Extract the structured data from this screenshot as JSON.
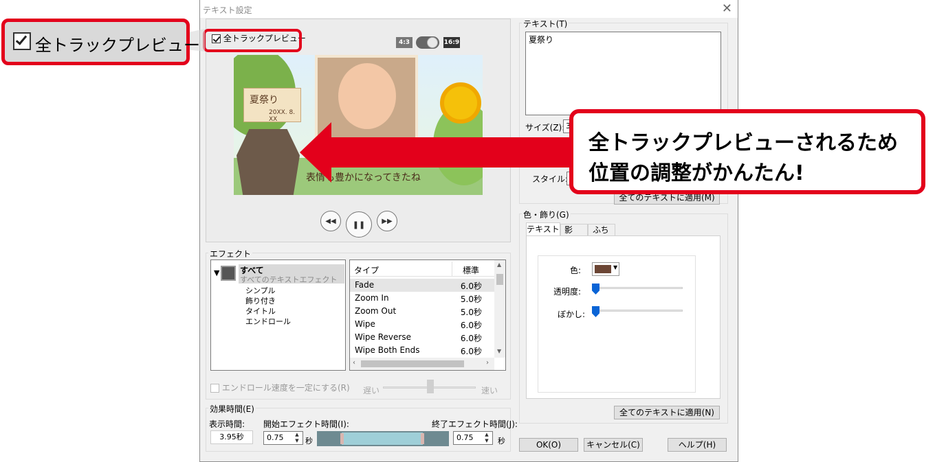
{
  "dialog": {
    "title": "テキスト設定",
    "all_track_preview_label": "全トラックプレビュー",
    "aspect_left": "4:3",
    "aspect_right": "16:9"
  },
  "callout": {
    "zoom_label": "全トラックプレビュー",
    "message_line1": "全トラックプレビューされるため",
    "message_line2": "位置の調整がかんたん!"
  },
  "preview": {
    "sign_title": "夏祭り",
    "sign_date": "20XX. 8. XX",
    "caption": "表情も豊かになってきたね"
  },
  "effects": {
    "legend": "エフェクト",
    "tree_root": "すべて",
    "tree_root_sub": "すべてのテキストエフェクト",
    "tree_items": [
      "シンプル",
      "飾り付き",
      "タイトル",
      "エンドロール"
    ],
    "col_type": "タイプ",
    "col_standard": "標準",
    "rows": [
      {
        "name": "Fade",
        "dur": "6.0秒"
      },
      {
        "name": "Zoom In",
        "dur": "5.0秒"
      },
      {
        "name": "Zoom Out",
        "dur": "5.0秒"
      },
      {
        "name": "Wipe",
        "dur": "6.0秒"
      },
      {
        "name": "Wipe Reverse",
        "dur": "6.0秒"
      },
      {
        "name": "Wipe Both Ends",
        "dur": "6.0秒"
      }
    ],
    "endroll_label": "エンドロール速度を一定にする(R)",
    "slow": "遅い",
    "fast": "速い"
  },
  "timing": {
    "legend": "効果時間(E)",
    "display_label": "表示時間:",
    "display_value": "3.95秒",
    "start_label": "開始エフェクト時間(I):",
    "start_value": "0.75",
    "end_label": "終了エフェクト時間(J):",
    "end_value": "0.75",
    "sec": "秒"
  },
  "text_panel": {
    "legend": "テキスト(T)",
    "text_value": "夏祭り",
    "size_label": "サイズ(Z):",
    "size_value": "3",
    "style_label": "スタイル:",
    "apply_all": "全てのテキストに適用(M)"
  },
  "color_panel": {
    "legend": "色・飾り(G)",
    "tabs": [
      "テキスト",
      "影",
      "ふち"
    ],
    "color_label": "色:",
    "color_value": "#6b4534",
    "opacity_label": "透明度:",
    "blur_label": "ぼかし:",
    "apply_all": "全てのテキストに適用(N)"
  },
  "buttons": {
    "ok": "OK(O)",
    "cancel": "キャンセル(C)",
    "help": "ヘルプ(H)"
  },
  "colors": {
    "accent_red": "#e3001b",
    "slider_blue": "#0a64d6"
  }
}
